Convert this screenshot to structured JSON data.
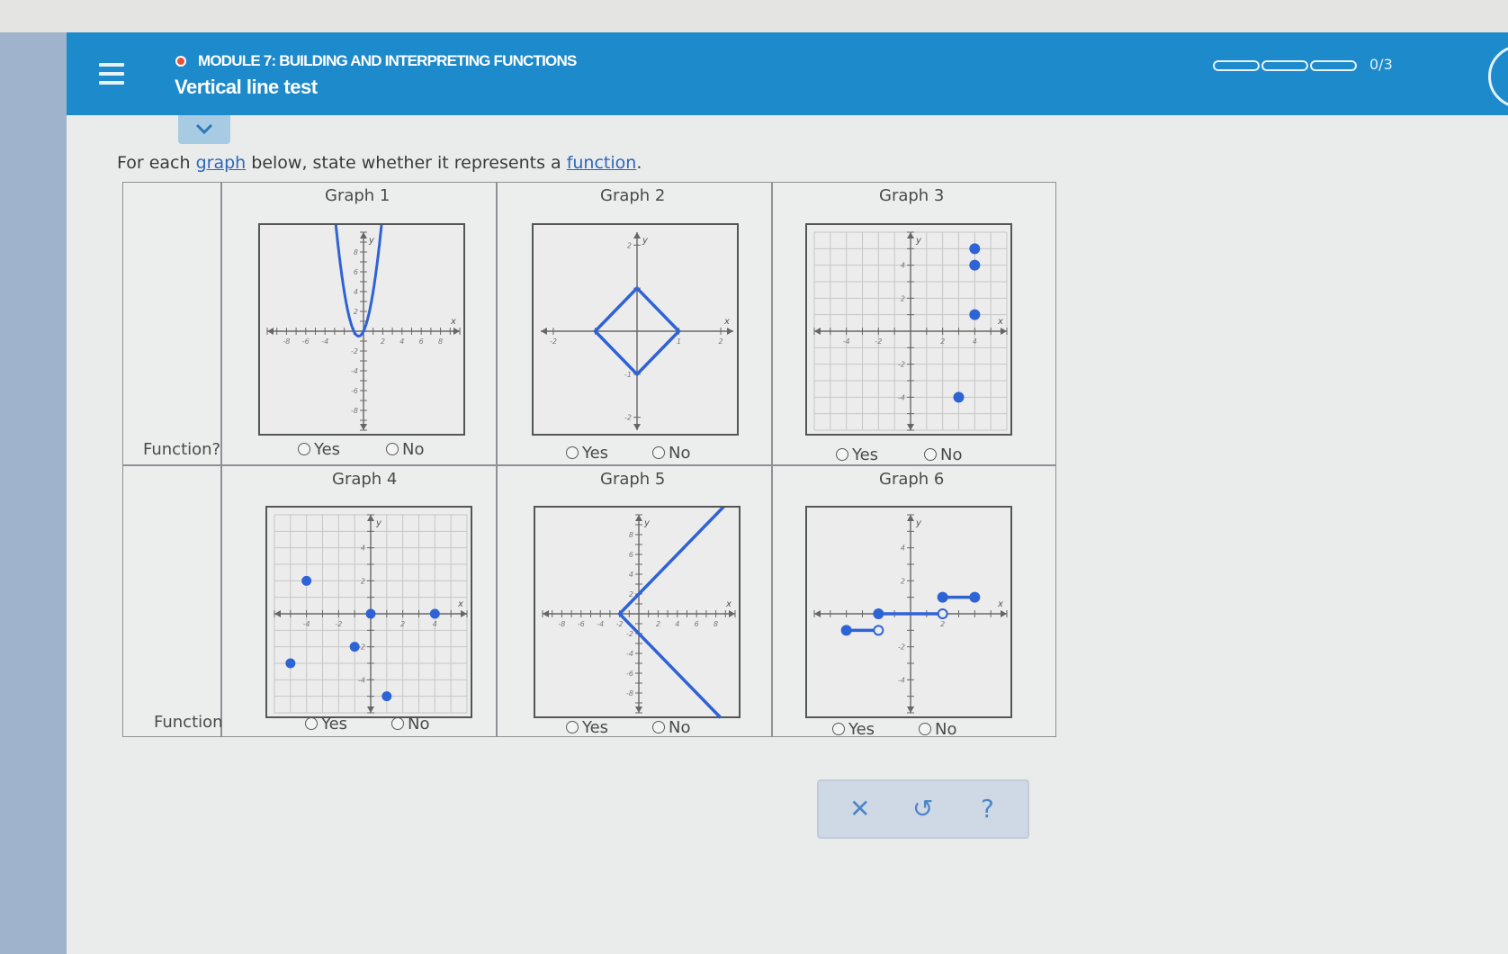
{
  "header": {
    "module_label": "MODULE 7: BUILDING AND INTERPRETING FUNCTIONS",
    "page_title": "Vertical line test",
    "progress_text": "0/3",
    "progress_segments": 3,
    "progress_filled": 0
  },
  "question": {
    "prompt_before": "For each ",
    "prompt_link1": "graph",
    "prompt_mid": " below, state whether it represents a ",
    "prompt_link2": "function",
    "prompt_after": ".",
    "function_label": "Function?",
    "yes_label": "Yes",
    "no_label": "No"
  },
  "graphs": [
    {
      "title": "Graph 1",
      "xticks": [
        "-8",
        "-6",
        "-4",
        "2",
        "4",
        "6",
        "8"
      ],
      "yticks": [
        "8",
        "6",
        "4",
        "2",
        "-2",
        "-4",
        "-6",
        "-8"
      ],
      "axis_x": "x",
      "axis_y": "y"
    },
    {
      "title": "Graph 2",
      "xticks": [
        "-2",
        "1",
        "2"
      ],
      "yticks": [
        "2",
        "-1",
        "-2"
      ],
      "axis_x": "x",
      "axis_y": "y"
    },
    {
      "title": "Graph 3",
      "xticks": [
        "-4",
        "-2",
        "2",
        "4"
      ],
      "yticks": [
        "4",
        "2",
        "-2",
        "-4"
      ],
      "axis_x": "x",
      "axis_y": "y"
    },
    {
      "title": "Graph 4",
      "xticks": [
        "-4",
        "-2",
        "2",
        "4"
      ],
      "yticks": [
        "4",
        "2",
        "-2",
        "-4"
      ],
      "axis_x": "x",
      "axis_y": "y"
    },
    {
      "title": "Graph 5",
      "xticks": [
        "-8",
        "-6",
        "-4",
        "-2",
        "2",
        "4",
        "6",
        "8"
      ],
      "yticks": [
        "8",
        "6",
        "4",
        "2",
        "-2",
        "-4",
        "-6",
        "-8"
      ],
      "axis_x": "x",
      "axis_y": "y"
    },
    {
      "title": "Graph 6",
      "xticks": [
        "2"
      ],
      "yticks": [
        "4",
        "2",
        "-2",
        "-4"
      ],
      "axis_x": "x",
      "axis_y": "y"
    }
  ],
  "graph_data": {
    "graph1": {
      "type": "parabola",
      "vertex": [
        -0.5,
        -0.5
      ],
      "stretch": 2
    },
    "graph2": {
      "type": "diamond",
      "vertices": [
        [
          0,
          1
        ],
        [
          1,
          0
        ],
        [
          0,
          -1
        ],
        [
          -1,
          0
        ]
      ]
    },
    "graph3": {
      "type": "points",
      "points": [
        [
          4,
          5
        ],
        [
          4,
          4
        ],
        [
          4,
          1
        ],
        [
          3,
          -4
        ]
      ]
    },
    "graph4": {
      "type": "points",
      "points": [
        [
          -4,
          2
        ],
        [
          0,
          0
        ],
        [
          4,
          0
        ],
        [
          -1,
          -2
        ],
        [
          -5,
          -3
        ],
        [
          1,
          -5
        ]
      ]
    },
    "graph5": {
      "type": "absolute-value-sideways",
      "vertex": [
        -2,
        0
      ]
    },
    "graph6": {
      "type": "step",
      "segments": [
        {
          "from": [
            -4,
            -1
          ],
          "to": [
            -2,
            -1
          ],
          "left_closed": true,
          "right_closed": false
        },
        {
          "from": [
            -2,
            0
          ],
          "to": [
            2,
            0
          ],
          "left_closed": true,
          "right_closed": false
        },
        {
          "from": [
            2,
            1
          ],
          "to": [
            4,
            1
          ],
          "left_closed": true,
          "right_closed": true
        }
      ]
    }
  },
  "actions": {
    "close_icon": "close-icon",
    "undo_icon": "undo-icon",
    "help_icon": "help-icon",
    "close_glyph": "✕",
    "undo_glyph": "↺",
    "help_glyph": "?"
  },
  "colors": {
    "header_bg": "#1d8acb",
    "plot_blue": "#2e63d6",
    "module_dot": "#e8503e"
  }
}
